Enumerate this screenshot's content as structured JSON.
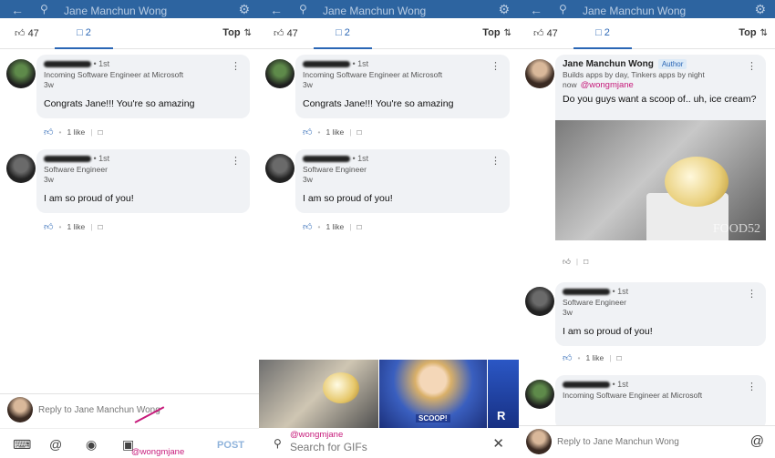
{
  "header": {
    "title": "Jane Manchun Wong",
    "back_icon": "arrow-back-icon",
    "search_icon": "search-icon",
    "settings_icon": "gear-icon"
  },
  "tabs": {
    "likes_count": "47",
    "comments_count": "2",
    "sort_label": "Top"
  },
  "comments": [
    {
      "degree": "• 1st",
      "headline": "Incoming Software Engineer at Microsoft",
      "time": "3w",
      "text": "Congrats Jane!!! You're so amazing",
      "likes": "1 like"
    },
    {
      "degree": "• 1st",
      "headline": "Software Engineer",
      "time": "3w",
      "text": "I am so proud of you!",
      "likes": "1 like"
    }
  ],
  "author_comment": {
    "name": "Jane Manchun Wong",
    "badge": "Author",
    "headline": "Builds apps by day, Tinkers apps by night",
    "time": "now",
    "mention": "@wongmjane",
    "text": "Do you guys want a scoop of.. uh, ice cream?",
    "gif_watermark": "FOOD52"
  },
  "reply": {
    "placeholder": "Reply to Jane Manchun Wong",
    "at_symbol": "@"
  },
  "toolbar": {
    "mention": "@wongmjane",
    "post_label": "POST"
  },
  "gif_search": {
    "mention": "@wongmjane",
    "placeholder": "Search for GIFs",
    "gif_caption": "SCOOP!",
    "gif_letter": "R"
  }
}
